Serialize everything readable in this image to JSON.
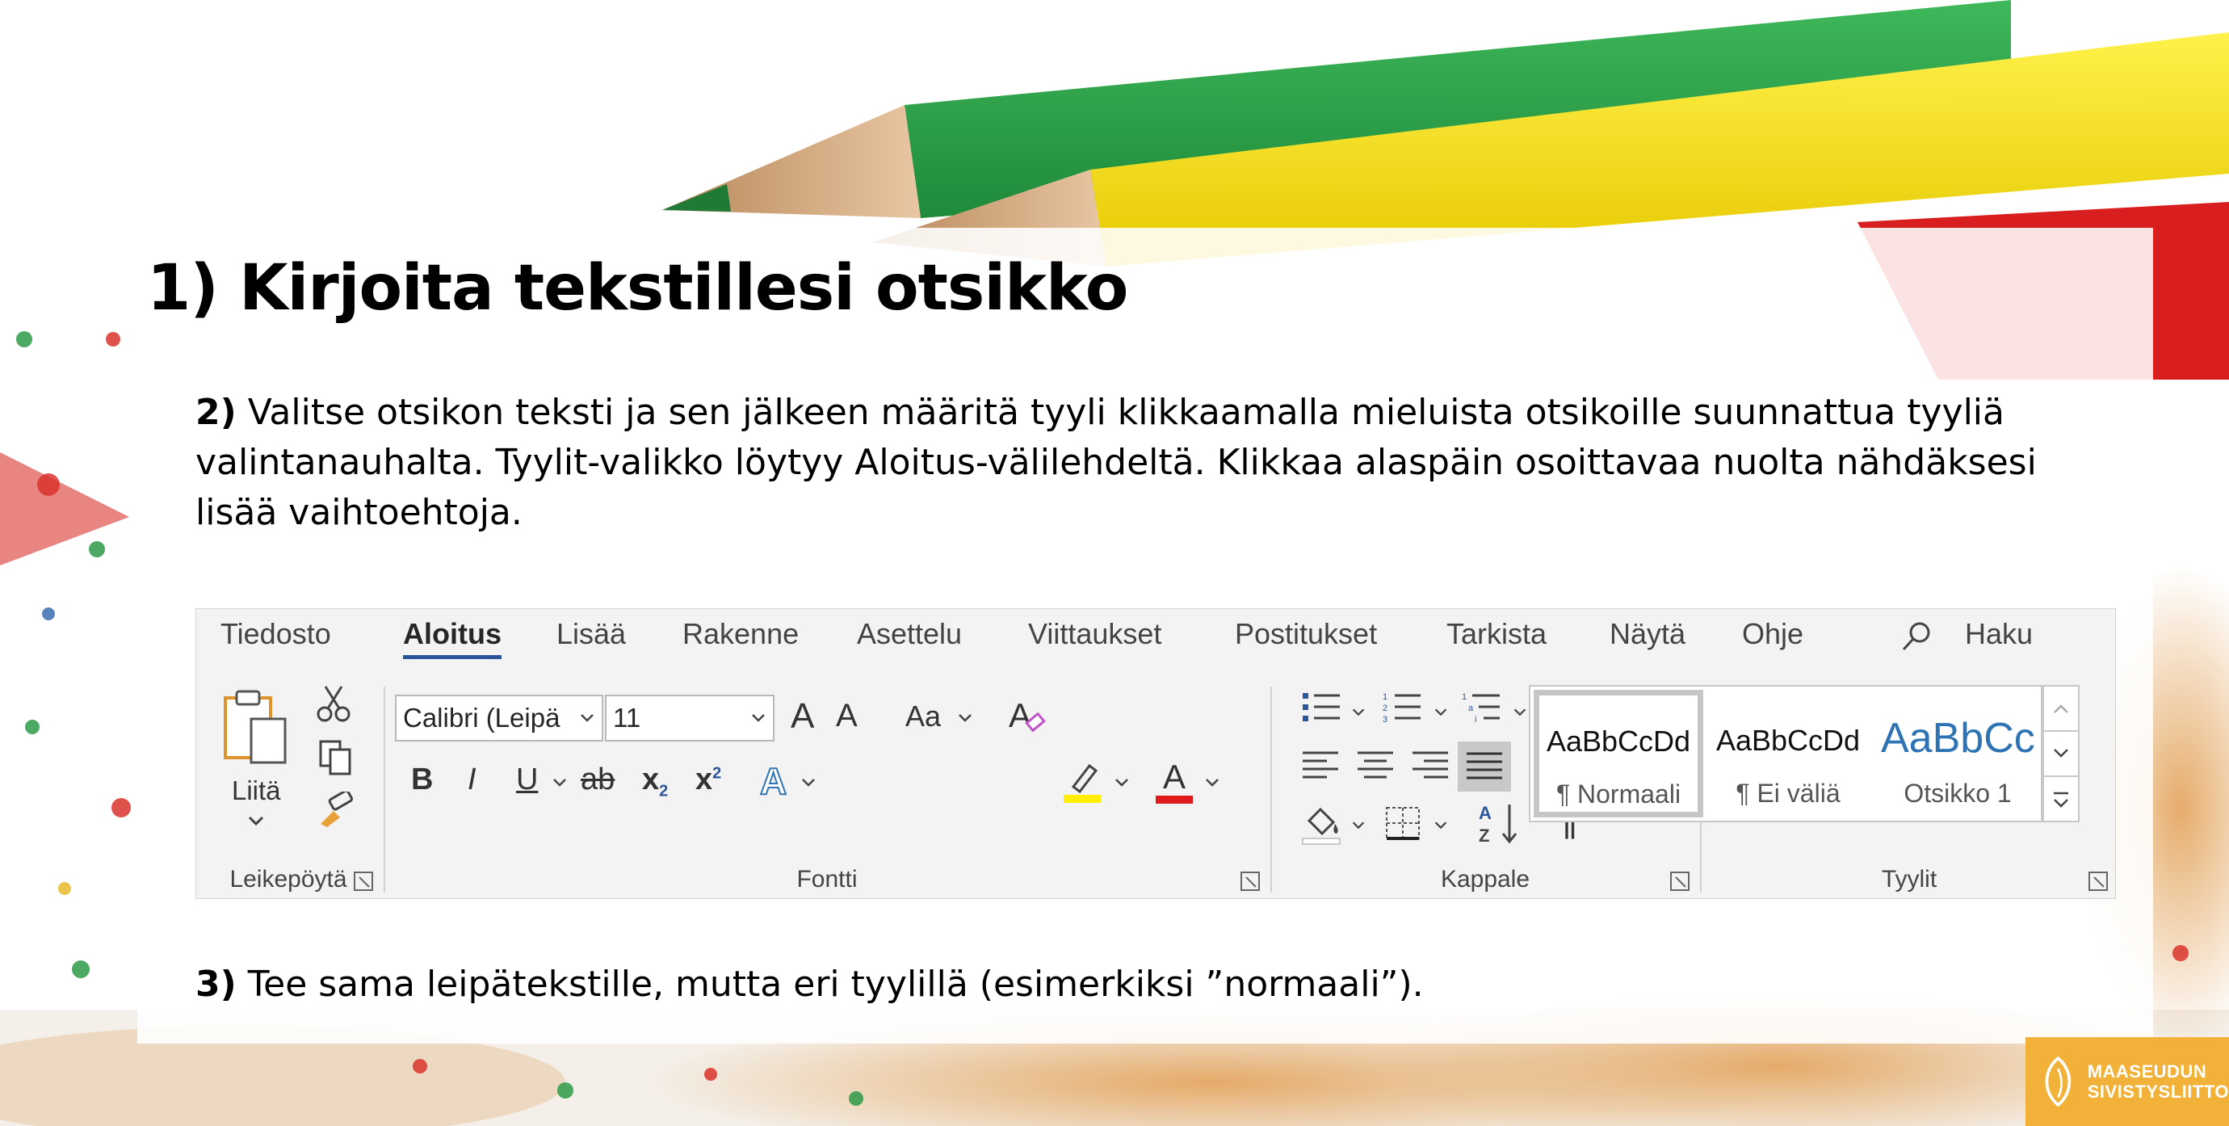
{
  "slide": {
    "title": "1) Kirjoita tekstillesi otsikko",
    "step2_label": "2)",
    "step2_text": " Valitse otsikon teksti ja sen jälkeen määritä tyyli klikkaamalla mieluista otsikoille suunnattua tyyliä valintanauhalta. Tyylit-valikko löytyy Aloitus-välilehdeltä. Klikkaa alaspäin osoittavaa nuolta nähdäksesi lisää vaihtoehtoja.",
    "step3_label": "3)",
    "step3_text": " Tee sama leipätekstille, mutta eri tyylillä (esimerkiksi ”normaali”)."
  },
  "ribbon": {
    "tabs": [
      "Tiedosto",
      "Aloitus",
      "Lisää",
      "Rakenne",
      "Asettelu",
      "Viittaukset",
      "Postitukset",
      "Tarkista",
      "Näytä",
      "Ohje"
    ],
    "active_tab": "Aloitus",
    "search_label": "Haku",
    "clipboard": {
      "paste_label": "Liitä",
      "group_label": "Leikepöytä"
    },
    "font": {
      "font_name": "Calibri (Leipä",
      "font_size": "11",
      "case_label": "Aa",
      "bold": "B",
      "italic": "I",
      "underline": "U",
      "strike": "ab",
      "subscript": "x",
      "sub_mark": "2",
      "superscript": "x",
      "sup_mark": "2",
      "grow_label": "A",
      "shrink_label": "A",
      "effects_label": "A",
      "color_label": "A",
      "group_label": "Fontti"
    },
    "paragraph": {
      "group_label": "Kappale",
      "pilcrow": "¶"
    },
    "styles": {
      "items": [
        {
          "preview": "AaBbCcDd",
          "name": "¶ Normaali"
        },
        {
          "preview": "AaBbCcDd",
          "name": "¶ Ei väliä"
        },
        {
          "preview": "AaBbCc",
          "name": "Otsikko 1"
        }
      ],
      "group_label": "Tyylit"
    },
    "colors": {
      "accent": "#2b579a",
      "heading_style": "#2e74b5",
      "font_color": "#e11b1b",
      "highlight": "#ffee00"
    }
  },
  "logo": {
    "line1": "MAASEUDUN",
    "line2": "SIVISTYSLIITTO"
  }
}
